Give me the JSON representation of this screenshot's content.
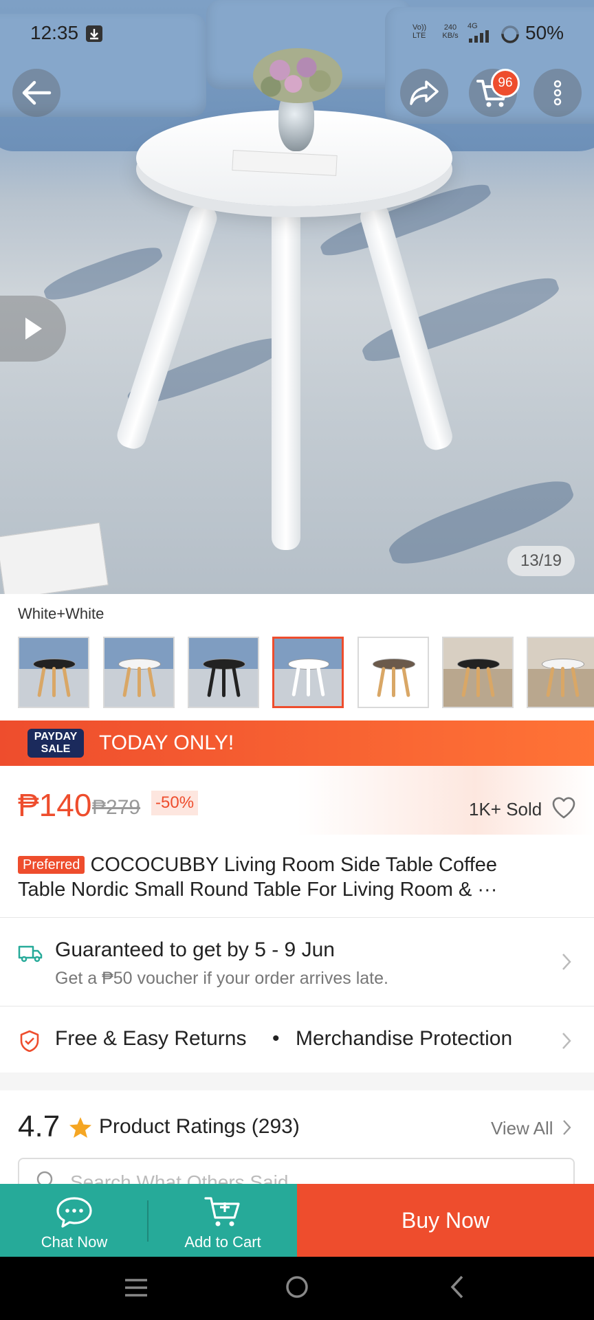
{
  "status_bar": {
    "time": "12:35",
    "network_top": "Vo)) LTE",
    "speed": "240 KB/s",
    "net_type": "4G",
    "battery": "50%"
  },
  "header": {
    "cart_count": "96"
  },
  "gallery": {
    "counter": "13/19"
  },
  "variant": {
    "label": "White+White",
    "thumbnails": [
      {
        "name": "black-top-wood-legs",
        "top": "#222222",
        "legs": "#d9a766",
        "selected": false
      },
      {
        "name": "white-top-wood-legs",
        "top": "#f4f4f4",
        "legs": "#d9a766",
        "selected": false
      },
      {
        "name": "black-top-black-legs",
        "top": "#222222",
        "legs": "#222222",
        "selected": false
      },
      {
        "name": "white-top-white-legs",
        "top": "#ffffff",
        "legs": "#ffffff",
        "selected": true
      },
      {
        "name": "walnut-top-wood-legs",
        "top": "#6b5a4b",
        "legs": "#d9a766",
        "selected": false
      },
      {
        "name": "black-two-tier",
        "top": "#222222",
        "legs": "#d9a766",
        "selected": false
      },
      {
        "name": "white-two-tier",
        "top": "#f4f4f4",
        "legs": "#d9a766",
        "selected": false
      }
    ]
  },
  "promo": {
    "badge_line1": "PAYDAY",
    "badge_line2": "SALE",
    "text": "TODAY ONLY!"
  },
  "price": {
    "current": "₱140",
    "original": "₱279",
    "discount": "-50%",
    "sold": "1K+ Sold"
  },
  "product": {
    "tag": "Preferred",
    "title_line1": "COCOCUBBY Living Room Side Table Coffee",
    "title_line2": "Table Nordic Small Round Table For Living Room & ···"
  },
  "shipping": {
    "title": "Guaranteed to get by 5 - 9 Jun",
    "subtitle": "Get a ₱50 voucher if your order arrives late."
  },
  "returns": {
    "text1": "Free & Easy Returns",
    "separator": "•",
    "text2": "Merchandise Protection"
  },
  "ratings": {
    "score": "4.7",
    "label": "Product Ratings (293)",
    "view_all": "View All",
    "search_placeholder": "Search What Others Said"
  },
  "actions": {
    "chat": "Chat Now",
    "add_to_cart": "Add to Cart",
    "buy_now": "Buy Now"
  },
  "colors": {
    "brand": "#ee4d2d",
    "teal": "#26aa99",
    "star": "#f5a623"
  }
}
